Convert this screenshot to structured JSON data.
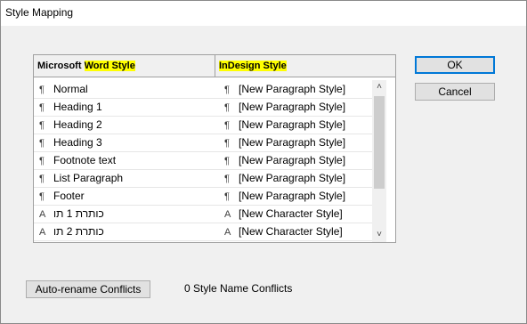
{
  "window": {
    "title": "Style Mapping"
  },
  "table": {
    "header_word_prefix": "Microsoft ",
    "header_word_highlight": "Word Style",
    "header_indesign": "InDesign Style",
    "rows": [
      {
        "word_icon": "¶",
        "word": "Normal",
        "indesign_icon": "¶",
        "indesign": "[New Paragraph Style]"
      },
      {
        "word_icon": "¶",
        "word": "Heading 1",
        "indesign_icon": "¶",
        "indesign": "[New Paragraph Style]"
      },
      {
        "word_icon": "¶",
        "word": "Heading 2",
        "indesign_icon": "¶",
        "indesign": "[New Paragraph Style]"
      },
      {
        "word_icon": "¶",
        "word": "Heading 3",
        "indesign_icon": "¶",
        "indesign": "[New Paragraph Style]"
      },
      {
        "word_icon": "¶",
        "word": "Footnote text",
        "indesign_icon": "¶",
        "indesign": "[New Paragraph Style]"
      },
      {
        "word_icon": "¶",
        "word": "List Paragraph",
        "indesign_icon": "¶",
        "indesign": "[New Paragraph Style]"
      },
      {
        "word_icon": "¶",
        "word": "Footer",
        "indesign_icon": "¶",
        "indesign": "[New Paragraph Style]"
      },
      {
        "word_icon": "A",
        "word": "כותרת 1 תו",
        "indesign_icon": "A",
        "indesign": "[New Character Style]"
      },
      {
        "word_icon": "A",
        "word": "כותרת 2 תו",
        "indesign_icon": "A",
        "indesign": "[New Character Style]"
      }
    ]
  },
  "buttons": {
    "ok": "OK",
    "cancel": "Cancel",
    "auto_rename": "Auto-rename Conflicts"
  },
  "status": {
    "conflicts": "0 Style Name Conflicts"
  },
  "icons": {
    "paragraph": "pilcrow-icon",
    "character": "character-style-icon",
    "scroll_up": "chevron-up-icon",
    "scroll_down": "chevron-down-icon"
  }
}
